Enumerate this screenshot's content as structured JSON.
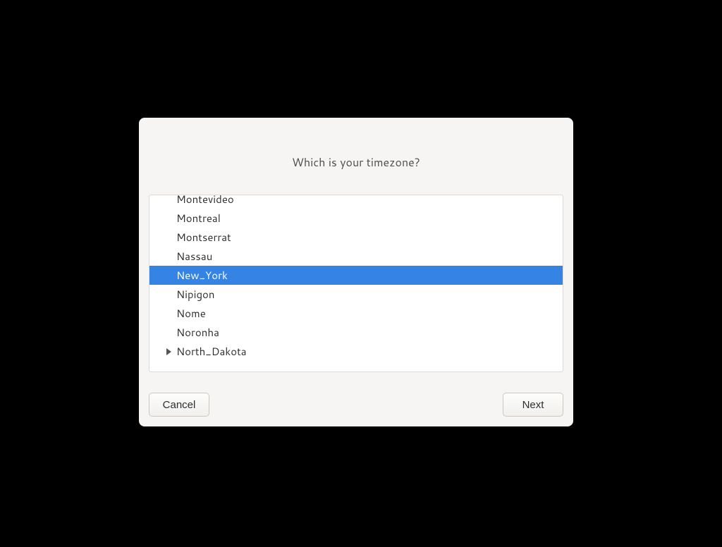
{
  "dialog": {
    "title": "Which is your timezone?",
    "selected_index": 4,
    "items": [
      {
        "label": "Montevideo",
        "expandable": false
      },
      {
        "label": "Montreal",
        "expandable": false
      },
      {
        "label": "Montserrat",
        "expandable": false
      },
      {
        "label": "Nassau",
        "expandable": false
      },
      {
        "label": "New_York",
        "expandable": false
      },
      {
        "label": "Nipigon",
        "expandable": false
      },
      {
        "label": "Nome",
        "expandable": false
      },
      {
        "label": "Noronha",
        "expandable": false
      },
      {
        "label": "North_Dakota",
        "expandable": true
      }
    ],
    "buttons": {
      "cancel": "Cancel",
      "next": "Next"
    }
  }
}
